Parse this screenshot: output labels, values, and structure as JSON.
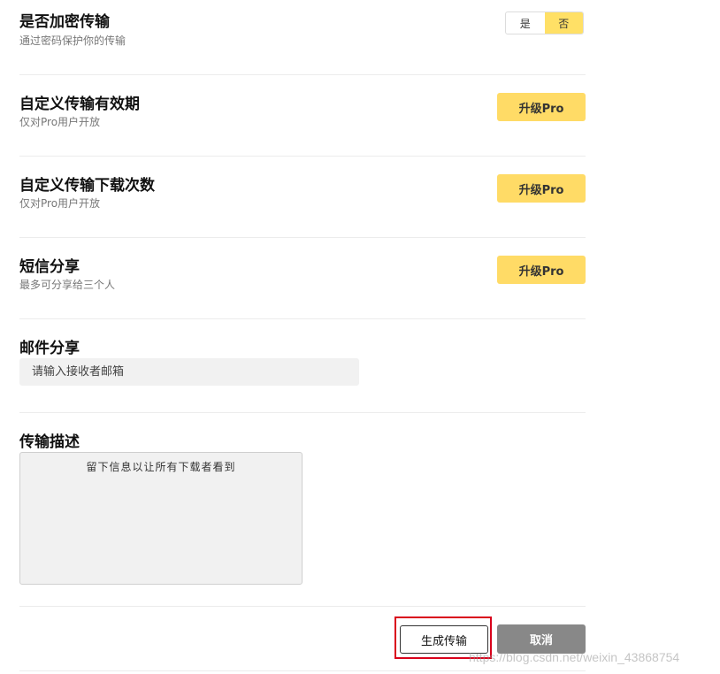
{
  "encrypt": {
    "title": "是否加密传输",
    "subtitle": "通过密码保护你的传输",
    "options": {
      "yes": "是",
      "no": "否"
    },
    "selected": "否"
  },
  "validity": {
    "title": "自定义传输有效期",
    "subtitle": "仅对Pro用户开放",
    "button": "升级Pro"
  },
  "download_count": {
    "title": "自定义传输下载次数",
    "subtitle": "仅对Pro用户开放",
    "button": "升级Pro"
  },
  "sms_share": {
    "title": "短信分享",
    "subtitle": "最多可分享给三个人",
    "button": "升级Pro"
  },
  "email_share": {
    "title": "邮件分享",
    "placeholder": "请输入接收者邮箱"
  },
  "description": {
    "title": "传输描述",
    "placeholder": "留下信息以让所有下载者看到"
  },
  "actions": {
    "generate": "生成传输",
    "cancel": "取消"
  },
  "watermark": "https://blog.csdn.net/weixin_43868754",
  "colors": {
    "accent": "#ffdb66",
    "toggle_active": "#ffe066",
    "cancel_bg": "#888888",
    "highlight": "#d9001b"
  }
}
